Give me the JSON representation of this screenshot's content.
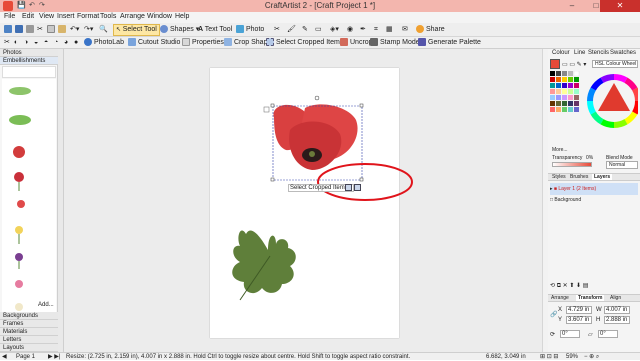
{
  "window": {
    "title": "CraftArtist 2 - [Craft Project 1 *]",
    "minimize": "–",
    "maximize": "□",
    "close": "✕"
  },
  "menu": [
    "File",
    "Edit",
    "View",
    "Insert",
    "Format",
    "Tools",
    "Arrange",
    "Window",
    "Help"
  ],
  "toolbar": {
    "select_tool": "Select Tool",
    "shapes": "Shapes",
    "text_tool": "Text Tool",
    "photo": "Photo",
    "share": "Share"
  },
  "context_toolbar": {
    "photolab": "PhotoLab",
    "cutout_studio": "Cutout Studio",
    "properties": "Properties",
    "crop_shape": "Crop Shape",
    "select_cropped": "Select Cropped Item(s)",
    "uncrop": "Uncrop",
    "stamp_mode": "Stamp Mode",
    "generate_palette": "Generate Palette"
  },
  "left_panel": {
    "tab_photos": "Photos",
    "tab_embellishments": "Embellishments",
    "add_label": "Add...",
    "sections": [
      "Backgrounds",
      "Frames",
      "Materials",
      "Letters",
      "Layouts"
    ]
  },
  "canvas": {
    "tooltip": "Select Cropped Item(s)"
  },
  "right_panel": {
    "top_tabs": [
      "Colour",
      "Line",
      "Stencils",
      "Swatches"
    ],
    "colour_model": "HSL Colour Wheel",
    "more_label": "More...",
    "transparency_label": "Transparency",
    "transparency_value": "0%",
    "blend_mode_label": "Blend Mode",
    "blend_mode_value": "Normal",
    "mid_tabs": [
      "Styles",
      "Brushes",
      "Layers"
    ],
    "layers": [
      {
        "name": "Layer 1 (2 Items)"
      },
      {
        "name": "Background"
      }
    ],
    "bottom_tabs": [
      "Arrange",
      "Transform",
      "Align"
    ],
    "transform": {
      "x_label": "X",
      "x_value": "4.729 in",
      "y_label": "Y",
      "y_value": "3.607 in",
      "w_label": "W",
      "w_value": "4.007 in",
      "h_label": "H",
      "h_value": "2.888 in",
      "rotation_value": "0°",
      "skew_value": "0°"
    }
  },
  "status": {
    "page": "Page 1",
    "message": "Resize: (2.725 in, 2.159 in), 4.007 in x 2.888 in. Hold Ctrl to toggle resize about centre. Hold Shift to toggle aspect ratio constraint.",
    "coords": "6.682, 3.049 in",
    "zoom": "59%"
  },
  "colors": {
    "accent": "#e74a38",
    "annotation": "#e0141b",
    "poppy_red": "#d93b3b",
    "leaf_green": "#5f7f3a"
  }
}
